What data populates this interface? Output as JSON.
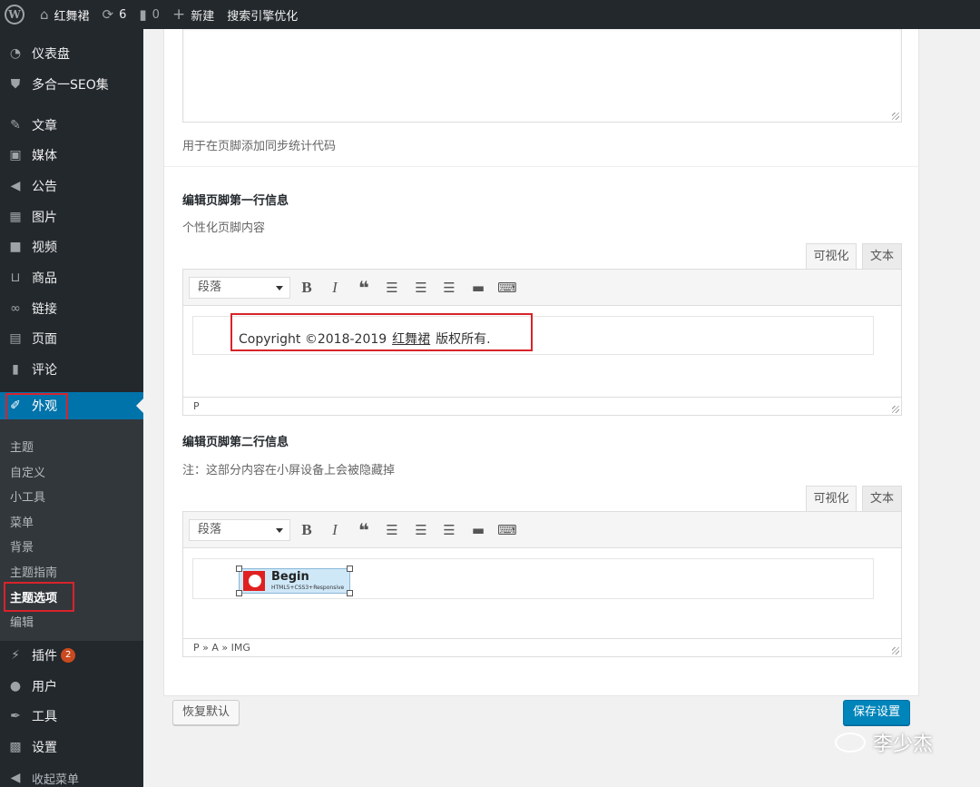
{
  "adminbar": {
    "site_name": "红舞裙",
    "updates_count": "6",
    "comments_count": "0",
    "new_label": "新建",
    "seo_label": "搜索引擎优化"
  },
  "sidebar": {
    "items": [
      {
        "label": "仪表盘",
        "icon": "dashboard-icon"
      },
      {
        "label": "多合一SEO集",
        "icon": "shield-icon"
      },
      {
        "label": "文章",
        "icon": "pin-icon"
      },
      {
        "label": "媒体",
        "icon": "media-icon"
      },
      {
        "label": "公告",
        "icon": "megaphone-icon"
      },
      {
        "label": "图片",
        "icon": "image-icon"
      },
      {
        "label": "视频",
        "icon": "video-icon"
      },
      {
        "label": "商品",
        "icon": "cart-icon"
      },
      {
        "label": "链接",
        "icon": "link-icon"
      },
      {
        "label": "页面",
        "icon": "page-icon"
      },
      {
        "label": "评论",
        "icon": "comment-icon"
      },
      {
        "label": "外观",
        "icon": "brush-icon"
      },
      {
        "label": "插件",
        "icon": "plugin-icon",
        "badge": "2"
      },
      {
        "label": "用户",
        "icon": "user-icon"
      },
      {
        "label": "工具",
        "icon": "wrench-icon"
      },
      {
        "label": "设置",
        "icon": "settings-icon"
      },
      {
        "label": "收起菜单",
        "icon": "collapse-icon"
      }
    ],
    "submenu": [
      "主题",
      "自定义",
      "小工具",
      "菜单",
      "背景",
      "主题指南",
      "主题选项",
      "编辑"
    ]
  },
  "main": {
    "stats_desc": "用于在页脚添加同步统计代码",
    "footer1": {
      "heading": "编辑页脚第一行信息",
      "desc": "个性化页脚内容",
      "content_before": "Copyright ©2018-2019",
      "content_link": "红舞裙",
      "content_after": "版权所有.",
      "path": "P"
    },
    "footer2": {
      "heading": "编辑页脚第二行信息",
      "desc": "注：这部分内容在小屏设备上会被隐藏掉",
      "logo_title": "Begin",
      "logo_sub": "HTML5+CSS3+Responsive",
      "path": "P » A » IMG"
    },
    "tab_visual": "可视化",
    "tab_text": "文本",
    "format_select": "段落",
    "reset_button": "恢复默认",
    "save_button": "保存设置"
  },
  "watermark": "李少杰",
  "colors": {
    "adminbar_bg": "#23282d",
    "active_menu": "#0073aa",
    "primary_button": "#0085ba",
    "highlight_box": "#d8232a"
  }
}
